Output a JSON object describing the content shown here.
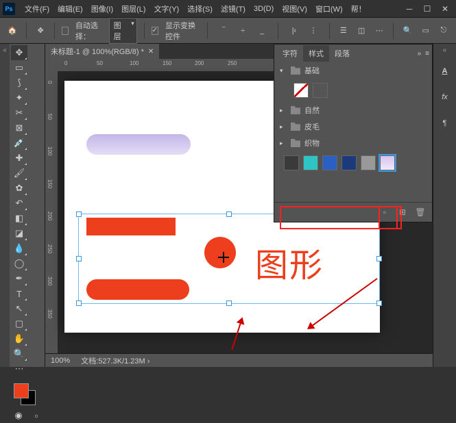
{
  "menu": {
    "file": "文件(F)",
    "edit": "编辑(E)",
    "image": "图像(I)",
    "layer": "图层(L)",
    "text": "文字(Y)",
    "select": "选择(S)",
    "filter": "滤镜(T)",
    "threed": "3D(D)",
    "view": "视图(V)",
    "window": "窗口(W)",
    "help": "帮！"
  },
  "options": {
    "auto_select": "自动选择：",
    "layer_dd": "图层",
    "show_transform": "显示变换控件"
  },
  "document": {
    "tab": "未标题-1 @ 100%(RGB/8) *",
    "zoom": "100%",
    "status_label": "文档:",
    "status_value": "527.3K/1.23M"
  },
  "ruler_h": {
    "0": "0",
    "50": "50",
    "100": "100",
    "150": "150",
    "200": "200",
    "250": "250"
  },
  "ruler_v": {
    "0": "0",
    "50": "50",
    "100": "100",
    "150": "150",
    "200": "200",
    "250": "250",
    "300": "300",
    "350": "350"
  },
  "canvas": {
    "big_text": "图形"
  },
  "panel": {
    "tab_char": "字符",
    "tab_styles": "样式",
    "tab_para": "段落",
    "cat_basic": "基础",
    "cat_natural": "自然",
    "cat_fur": "皮毛",
    "cat_fabric": "织物"
  },
  "chart_data": {
    "type": "table",
    "note": "no chart in image"
  }
}
